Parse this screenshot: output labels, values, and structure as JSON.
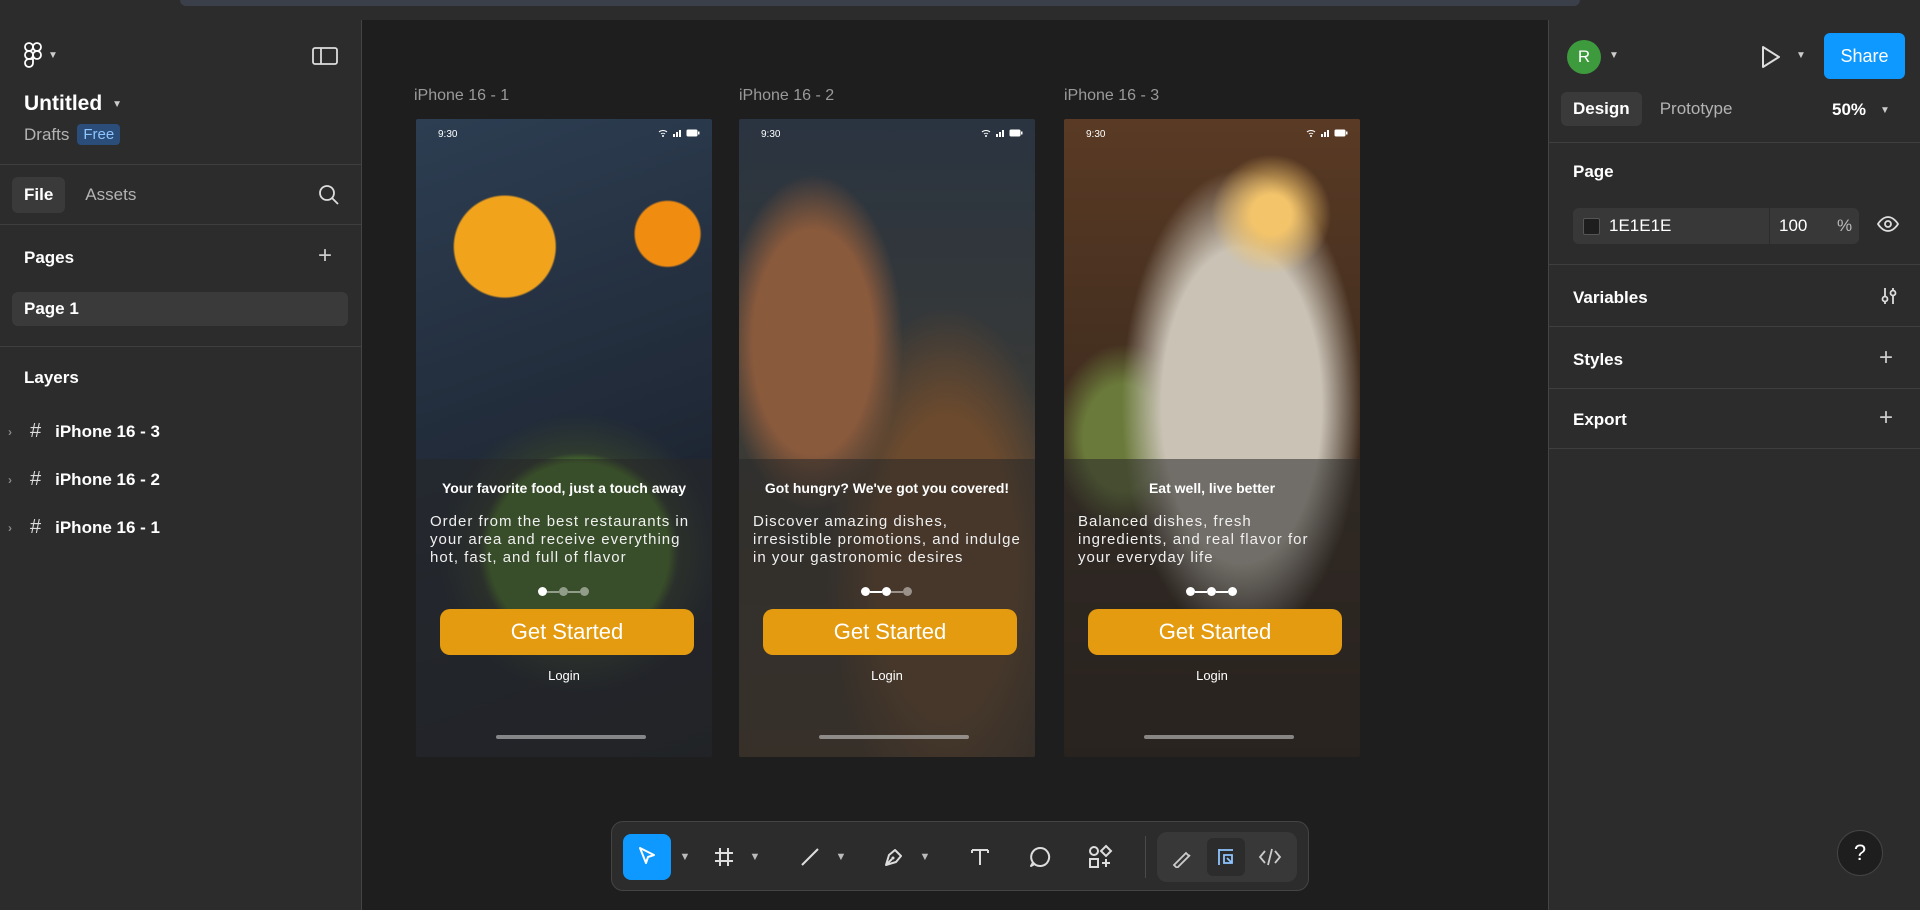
{
  "file": {
    "title": "Untitled",
    "location": "Drafts",
    "plan_badge": "Free"
  },
  "left_tabs": {
    "file": "File",
    "assets": "Assets"
  },
  "pages": {
    "heading": "Pages",
    "items": [
      "Page 1"
    ]
  },
  "layers": {
    "heading": "Layers",
    "items": [
      "iPhone 16 - 3",
      "iPhone 16 - 2",
      "iPhone 16 - 1"
    ]
  },
  "frames": [
    {
      "label": "iPhone 16 - 1",
      "time": "9:30",
      "title": "Your favorite food, just a touch away",
      "description": "Order from the best restaurants in your area and receive everything hot, fast, and full of flavor",
      "cta": "Get Started",
      "login": "Login",
      "active_dot": 1
    },
    {
      "label": "iPhone 16 - 2",
      "time": "9:30",
      "title": "Got hungry? We've got you covered!",
      "description": "Discover amazing dishes, irresistible promotions, and indulge in your gastronomic desires",
      "cta": "Get Started",
      "login": "Login",
      "active_dot": 2
    },
    {
      "label": "iPhone 16 - 3",
      "time": "9:30",
      "title": "Eat well, live better",
      "description": "Balanced dishes, fresh ingredients, and real flavor for your everyday life",
      "cta": "Get Started",
      "login": "Login",
      "active_dot": 3
    }
  ],
  "right_panel": {
    "avatar_initial": "R",
    "share_label": "Share",
    "tabs": {
      "design": "Design",
      "prototype": "Prototype"
    },
    "zoom": "50%",
    "page_heading": "Page",
    "page_color_hex": "1E1E1E",
    "page_opacity": "100",
    "page_opacity_unit": "%",
    "variables": "Variables",
    "styles": "Styles",
    "export": "Export",
    "help": "?"
  },
  "colors": {
    "accent": "#0d99ff",
    "cta": "#e49b0f",
    "avatar": "#3d9b3d",
    "canvas_bg": "#1e1e1e",
    "panel_bg": "#2c2c2c"
  },
  "toolbar": {
    "tools": [
      "move-tool",
      "frame-tool",
      "line-tool",
      "pen-tool",
      "text-tool",
      "comment-tool",
      "actions-tool",
      "draw-mode",
      "design-mode",
      "dev-mode"
    ]
  }
}
